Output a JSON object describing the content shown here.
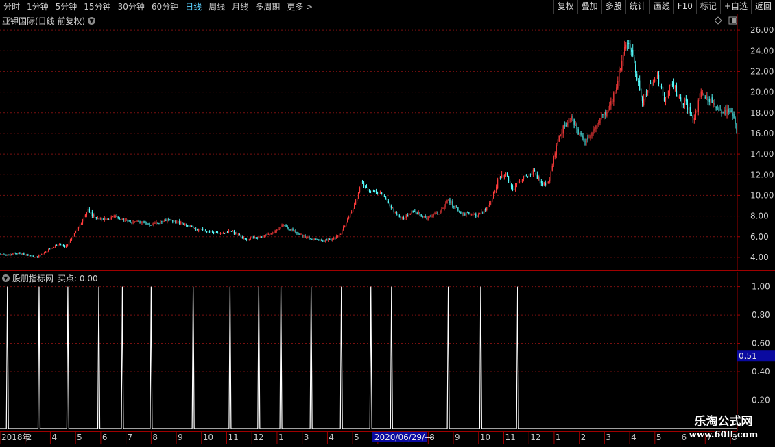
{
  "toolbar": {
    "periods": [
      {
        "label": "分时",
        "active": false
      },
      {
        "label": "1分钟",
        "active": false
      },
      {
        "label": "5分钟",
        "active": false
      },
      {
        "label": "15分钟",
        "active": false
      },
      {
        "label": "30分钟",
        "active": false
      },
      {
        "label": "60分钟",
        "active": false
      },
      {
        "label": "日线",
        "active": true
      },
      {
        "label": "周线",
        "active": false
      },
      {
        "label": "月线",
        "active": false
      },
      {
        "label": "多周期",
        "active": false
      },
      {
        "label": "更多 >",
        "active": false
      }
    ],
    "tools": [
      "复权",
      "叠加",
      "多股",
      "统计",
      "画线",
      "F10",
      "标记",
      "+自选",
      "返回"
    ]
  },
  "main_panel": {
    "title": "亚钾国际(日线 前复权)",
    "price_labels": [
      "26.00",
      "24.00",
      "22.00",
      "20.00",
      "18.00",
      "16.00",
      "14.00",
      "12.00",
      "10.00",
      "8.00",
      "6.00",
      "4.00"
    ]
  },
  "indicator_panel": {
    "title": "股朋指标网",
    "value_label": "买点: 0.00",
    "axis_labels": [
      "1.00",
      "0.80",
      "0.60",
      "0.40",
      "0.20"
    ],
    "current_value": "0.51"
  },
  "date_axis": {
    "labels": [
      "2018年",
      "2",
      "4",
      "5",
      "6",
      "7",
      "8",
      "9",
      "10",
      "11",
      "12",
      "1",
      "3",
      "4",
      "5",
      "6",
      "7",
      "8",
      "9",
      "10",
      "11",
      "12",
      "1",
      "2",
      "3",
      "4",
      "5",
      "6",
      "7",
      "8"
    ],
    "cursor_label": "2020/06/29/—"
  },
  "watermark": {
    "line1": "乐淘公式网",
    "line2": "www.60lt.com"
  },
  "colors": {
    "up": "#ff3c3c",
    "down": "#54fcfc",
    "grid": "#7a1010",
    "axis": "#a00000",
    "accent": "#5bd1ff",
    "signal": "#ffffff"
  },
  "chart_data": {
    "type": "candlestick",
    "price_axis": {
      "ylim": [
        3.0,
        27.0
      ],
      "ticks": [
        26,
        24,
        22,
        20,
        18,
        16,
        14,
        12,
        10,
        8,
        6,
        4
      ]
    },
    "close_path": [
      4.3,
      4.2,
      4.4,
      4.3,
      4.2,
      4.0,
      4.5,
      4.9,
      5.3,
      5.0,
      6.0,
      7.1,
      8.6,
      7.9,
      7.6,
      7.8,
      7.9,
      7.6,
      7.4,
      7.5,
      7.3,
      7.2,
      7.4,
      7.6,
      7.5,
      7.3,
      7.1,
      6.8,
      6.6,
      6.5,
      6.3,
      6.4,
      6.5,
      6.2,
      5.7,
      5.9,
      6.0,
      6.2,
      6.4,
      7.1,
      6.8,
      6.4,
      6.0,
      5.8,
      5.7,
      5.6,
      5.7,
      6.2,
      7.5,
      9.0,
      11.3,
      10.5,
      10.3,
      10.0,
      9.0,
      8.0,
      7.8,
      8.5,
      8.2,
      7.8,
      8.2,
      8.4,
      9.6,
      8.8,
      8.2,
      8.3,
      8.0,
      8.5,
      9.5,
      11.6,
      12.2,
      10.4,
      11.5,
      11.9,
      12.3,
      11.0,
      11.4,
      14.8,
      16.6,
      17.7,
      16.2,
      15.3,
      16.3,
      17.4,
      18.2,
      19.7,
      22.9,
      25.3,
      22.0,
      19.0,
      20.7,
      21.4,
      19.2,
      20.9,
      19.5,
      18.8,
      17.1,
      19.9,
      19.3,
      18.6,
      17.8,
      18.4,
      16.6
    ],
    "signal": {
      "type": "spike",
      "ylim": [
        0,
        1.08
      ],
      "ticks": [
        1.0,
        0.8,
        0.6,
        0.4,
        0.2
      ],
      "current": 0.51,
      "buy_value": 0.0,
      "spike_bar_fractions": [
        0.01,
        0.053,
        0.092,
        0.134,
        0.166,
        0.205,
        0.262,
        0.312,
        0.351,
        0.381,
        0.422,
        0.463,
        0.503,
        0.531,
        0.608,
        0.652,
        0.702
      ]
    }
  }
}
